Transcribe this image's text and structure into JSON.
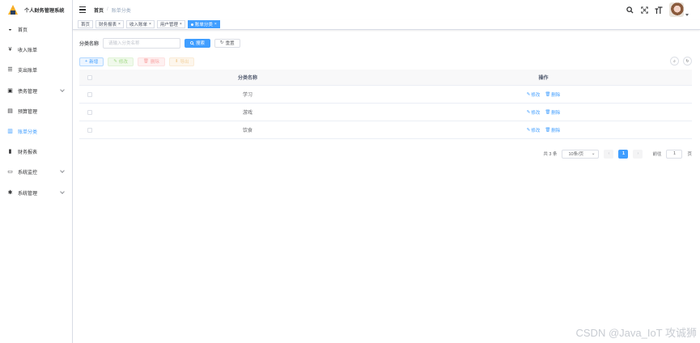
{
  "app": {
    "title": "个人财务管理系统"
  },
  "sidebar": {
    "items": [
      {
        "label": "首页",
        "icon": "dashboard-icon"
      },
      {
        "label": "收入账单",
        "icon": "yen-icon"
      },
      {
        "label": "支出账单",
        "icon": "list-icon"
      },
      {
        "label": "债务管理",
        "icon": "wallet-icon",
        "has_submenu": true
      },
      {
        "label": "预算管理",
        "icon": "budget-icon"
      },
      {
        "label": "账单分类",
        "icon": "category-icon",
        "active": true
      },
      {
        "label": "财务报表",
        "icon": "bar-chart-icon"
      },
      {
        "label": "系统监控",
        "icon": "monitor-icon",
        "has_submenu": true
      },
      {
        "label": "系统管理",
        "icon": "gear-icon",
        "has_submenu": true
      }
    ]
  },
  "breadcrumb": {
    "home": "首页",
    "sep": "/",
    "current": "账单分类"
  },
  "tags": [
    {
      "label": "首页",
      "closable": false
    },
    {
      "label": "财务报表",
      "closable": true
    },
    {
      "label": "收入账单",
      "closable": true
    },
    {
      "label": "用户管理",
      "closable": true
    },
    {
      "label": "账单分类",
      "closable": true,
      "active": true
    }
  ],
  "search": {
    "label": "分类名称",
    "placeholder": "请输入分类名称",
    "search_button": "搜索",
    "reset_button": "重置"
  },
  "actions": {
    "add": "新增",
    "edit": "修改",
    "delete": "删除",
    "export": "导出"
  },
  "table": {
    "headers": {
      "name": "分类名称",
      "op": "操作"
    },
    "rows": [
      {
        "name": "学习"
      },
      {
        "name": "游戏"
      },
      {
        "name": "饮食"
      }
    ],
    "row_actions": {
      "edit": "修改",
      "delete": "删除"
    }
  },
  "pagination": {
    "total": "共 3 条",
    "page_size": "10条/页",
    "current_page": "1",
    "goto_label": "前往",
    "goto_value": "1",
    "page_unit": "页"
  },
  "watermark": "CSDN @Java_IoT 攻诚狮",
  "colors": {
    "primary": "#409eff",
    "border": "#dcdfe6"
  }
}
